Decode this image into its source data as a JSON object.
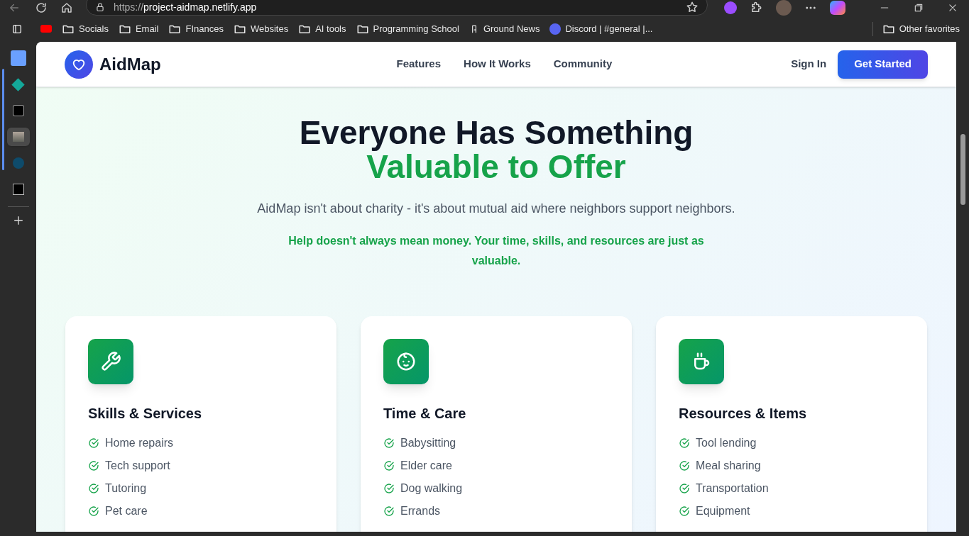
{
  "browser": {
    "url_scheme": "https://",
    "url_host": "project-aidmap.netlify.app",
    "bookmarks": [
      {
        "kind": "youtube"
      },
      {
        "kind": "folder",
        "label": "Socials"
      },
      {
        "kind": "folder",
        "label": "Email"
      },
      {
        "kind": "folder",
        "label": "FInances"
      },
      {
        "kind": "folder",
        "label": "Websites"
      },
      {
        "kind": "folder",
        "label": "AI tools"
      },
      {
        "kind": "folder",
        "label": "Programming School"
      },
      {
        "kind": "news",
        "label": "Ground News"
      },
      {
        "kind": "discord",
        "label": "Discord | #general |..."
      }
    ],
    "other_favorites": "Other favorites",
    "vertical_tabs": [
      {
        "kind": "triangle",
        "selected": false
      },
      {
        "kind": "diamond",
        "selected": false
      },
      {
        "kind": "b",
        "selected": false
      },
      {
        "kind": "picture",
        "selected": true
      },
      {
        "kind": "hex",
        "selected": false
      },
      {
        "kind": "spider",
        "selected": false
      }
    ]
  },
  "header": {
    "brand": "AidMap",
    "nav": [
      "Features",
      "How It Works",
      "Community"
    ],
    "sign_in": "Sign In",
    "cta": "Get Started"
  },
  "hero": {
    "title": "Everyone Has Something",
    "title_accent": "Valuable to Offer",
    "subtitle": "AidMap isn't about charity - it's about mutual aid where neighbors support neighbors.",
    "note": "Help doesn't always mean money. Your time, skills, and resources are just as valuable."
  },
  "cards": [
    {
      "kind": "wrench",
      "title": "Skills & Services",
      "items": [
        "Home repairs",
        "Tech support",
        "Tutoring",
        "Pet care"
      ]
    },
    {
      "kind": "baby",
      "title": "Time & Care",
      "items": [
        "Babysitting",
        "Elder care",
        "Dog walking",
        "Errands"
      ]
    },
    {
      "kind": "cup",
      "title": "Resources & Items",
      "items": [
        "Tool lending",
        "Meal sharing",
        "Transportation",
        "Equipment"
      ]
    }
  ]
}
